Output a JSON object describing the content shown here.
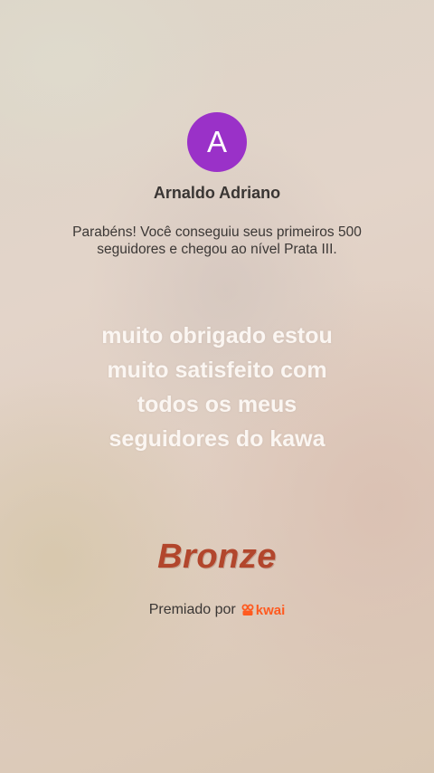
{
  "profile": {
    "avatar_letter": "A",
    "avatar_color": "#9a31c8",
    "name": "Arnaldo Adriano"
  },
  "achievement": {
    "text": "Parabéns! Você conseguiu seus primeiros 500 seguidores e chegou ao nível Prata III."
  },
  "message": {
    "lines": [
      "muito obrigado estou",
      "muito satisfeito com",
      "todos os meus",
      "seguidores do kawa"
    ]
  },
  "badge": {
    "label": "Bronze",
    "color": "#b2462c"
  },
  "footer": {
    "awarded_by": "Premiado por",
    "brand": "kwai",
    "brand_icon": "kwai-logo-icon",
    "brand_color": "#ff5a1f"
  }
}
